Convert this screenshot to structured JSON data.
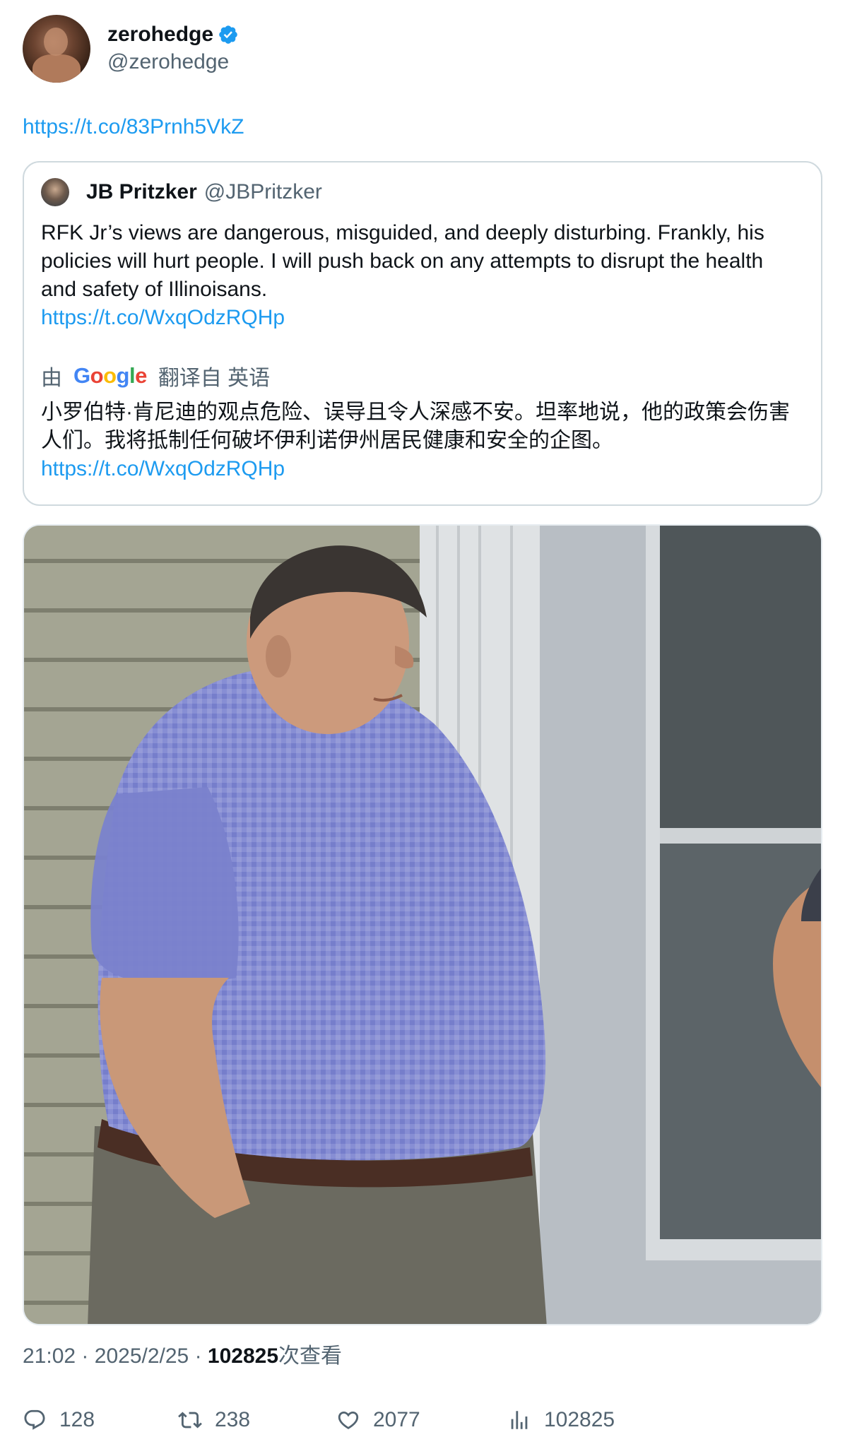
{
  "author": {
    "display_name": "zerohedge",
    "handle": "@zerohedge",
    "verified_color": "#1d9bf0"
  },
  "tweet": {
    "link": "https://t.co/83Prnh5VkZ"
  },
  "quoted": {
    "display_name": "JB Pritzker",
    "handle": "@JBPritzker",
    "text": "RFK Jr’s views are dangerous, misguided, and deeply disturbing. Frankly, his policies will hurt people. I will push back on any attempts to disrupt the health and safety of Illinoisans.",
    "link": "https://t.co/WxqOdzRQHp",
    "translation": {
      "by_label": "由",
      "provider": "Google",
      "from_label": "翻译自 英语",
      "text": "小罗伯特·肯尼迪的观点危险、误导且令人深感不安。坦率地说，他的政策会伤害人们。我将抵制任何破坏伊利诺伊州居民健康和安全的企图。",
      "link": "https://t.co/WxqOdzRQHp"
    }
  },
  "meta": {
    "time": "21:02",
    "date": "2025/2/25",
    "separator": "·",
    "views_count": "102825",
    "views_label": "次查看"
  },
  "actions": {
    "replies": "128",
    "retweets": "238",
    "likes": "2077",
    "views": "102825"
  },
  "colors": {
    "link": "#1d9bf0",
    "secondary_text": "#536471",
    "border": "#cfd9de"
  }
}
